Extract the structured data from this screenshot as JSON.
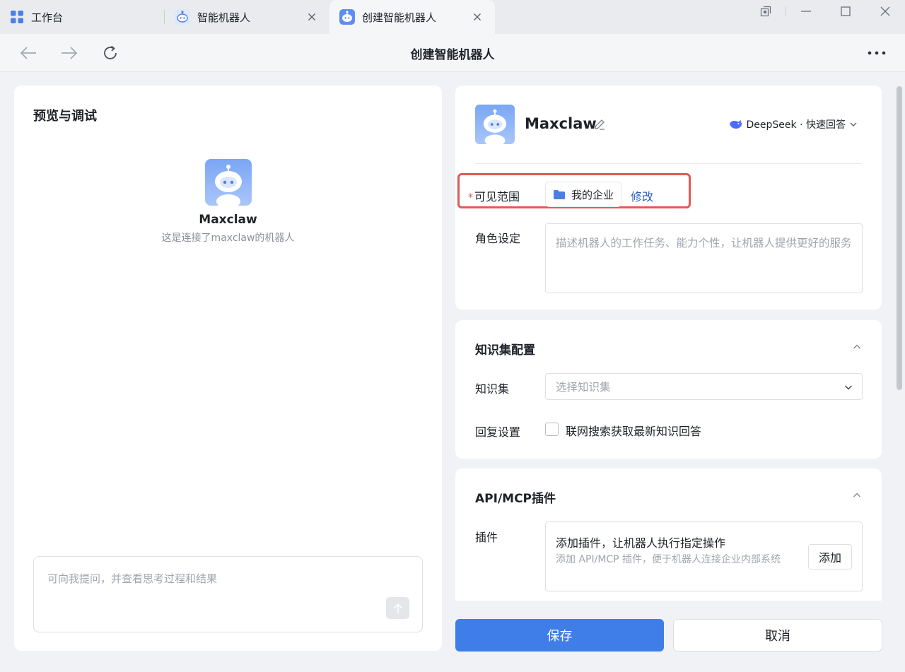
{
  "tabs": {
    "workbench": "工作台",
    "robots": "智能机器人",
    "create": "创建智能机器人"
  },
  "nav": {
    "title": "创建智能机器人"
  },
  "preview": {
    "title": "预览与调试",
    "bot_name": "Maxclaw",
    "bot_desc": "这是连接了maxclaw的机器人",
    "input_placeholder": "可向我提问，并查看思考过程和结果"
  },
  "basic": {
    "bot_name": "Maxclaw",
    "model": "DeepSeek · 快速回答",
    "visible_label": "可见范围",
    "required_mark": "*",
    "scope_value": "我的企业",
    "scope_edit": "修改",
    "role_label": "角色设定",
    "role_placeholder": "描述机器人的工作任务、能力个性，让机器人提供更好的服务"
  },
  "knowledge": {
    "title": "知识集配置",
    "kb_label": "知识集",
    "kb_placeholder": "选择知识集",
    "reply_label": "回复设置",
    "web_search_label": "联网搜索获取最新知识回答",
    "web_search_checked": false
  },
  "plugin": {
    "title": "API/MCP插件",
    "label": "插件",
    "main_text": "添加插件，让机器人执行指定操作",
    "sub_text": "添加 API/MCP 插件，便于机器人连接企业内部系统",
    "add_button": "添加"
  },
  "actions": {
    "save": "保存",
    "cancel": "取消"
  },
  "colors": {
    "accent": "#3f7de8",
    "highlight": "#e05a55",
    "link": "#2f5cc8"
  }
}
